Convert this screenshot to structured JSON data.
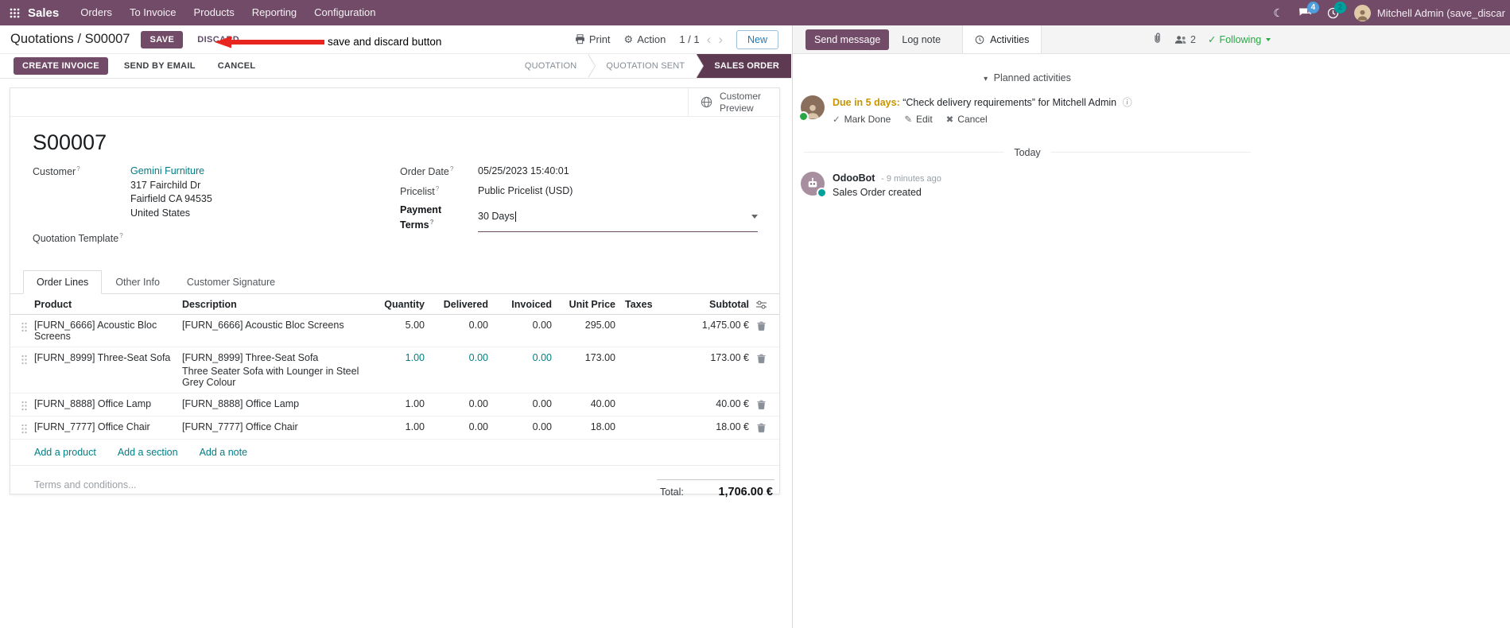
{
  "colors": {
    "primary": "#714B67",
    "statusbar_active": "#5e3a52",
    "link_teal": "#017e84",
    "warning_due": "#c79500",
    "success_green": "#28a745",
    "chat_badge_blue": "#4e9ddd",
    "activity_badge_teal": "#00a09d",
    "annotation_red": "#e8251f"
  },
  "ui": {
    "help": "?"
  },
  "icons": {
    "gear": "⚙",
    "moon": "☾",
    "caret_down": "▾",
    "check": "✓",
    "pencil": "✎",
    "cross": "✖",
    "info": "ⓘ",
    "chevron_left": "‹",
    "chevron_right": "›"
  },
  "annotation": {
    "label": "save and discard button"
  },
  "topbar": {
    "app": "Sales",
    "menus": [
      "Orders",
      "To Invoice",
      "Products",
      "Reporting",
      "Configuration"
    ],
    "chat_badge": "4",
    "activity_badge": "2",
    "user": "Mitchell Admin (save_discar"
  },
  "control": {
    "breadcrumb_parent": "Quotations",
    "breadcrumb_sep": "/",
    "breadcrumb_current": "S00007",
    "save": "SAVE",
    "discard": "DISCARD",
    "print": "Print",
    "action": "Action",
    "pager": "1 / 1",
    "new_label": "New"
  },
  "statusbar": {
    "buttons": [
      "CREATE INVOICE",
      "SEND BY EMAIL",
      "CANCEL"
    ],
    "states": [
      {
        "label": "QUOTATION",
        "active": false
      },
      {
        "label": "QUOTATION SENT",
        "active": false
      },
      {
        "label": "SALES ORDER",
        "active": true
      }
    ]
  },
  "sheet": {
    "customer_preview": "Customer Preview",
    "name": "S00007",
    "fields": {
      "customer_label": "Customer",
      "customer": "Gemini Furniture",
      "address_lines": [
        "317 Fairchild Dr",
        "Fairfield CA 94535",
        "United States"
      ],
      "quotation_template_label": "Quotation Template",
      "order_date_label": "Order Date",
      "order_date": "05/25/2023 15:40:01",
      "pricelist_label": "Pricelist",
      "pricelist": "Public Pricelist (USD)",
      "payment_terms_label": "Payment Terms",
      "payment_terms": "30 Days"
    },
    "tabs": [
      "Order Lines",
      "Other Info",
      "Customer Signature"
    ],
    "table": {
      "headers": [
        "Product",
        "Description",
        "Quantity",
        "Delivered",
        "Invoiced",
        "Unit Price",
        "Taxes",
        "Subtotal"
      ],
      "rows": [
        {
          "product": "[FURN_6666] Acoustic Bloc Screens",
          "description": "[FURN_6666] Acoustic Bloc Screens",
          "description2": "",
          "quantity": "5.00",
          "delivered": "0.00",
          "invoiced": "0.00",
          "unit_price": "295.00",
          "taxes": "",
          "subtotal": "1,475.00 €"
        },
        {
          "product": "[FURN_8999] Three-Seat Sofa",
          "description": "[FURN_8999] Three-Seat Sofa",
          "description2": "Three Seater Sofa with Lounger in Steel Grey Colour",
          "quantity": "1.00",
          "delivered": "0.00",
          "invoiced": "0.00",
          "unit_price": "173.00",
          "taxes": "",
          "subtotal": "173.00 €"
        },
        {
          "product": "[FURN_8888] Office Lamp",
          "description": "[FURN_8888] Office Lamp",
          "description2": "",
          "quantity": "1.00",
          "delivered": "0.00",
          "invoiced": "0.00",
          "unit_price": "40.00",
          "taxes": "",
          "subtotal": "40.00 €"
        },
        {
          "product": "[FURN_7777] Office Chair",
          "description": "[FURN_7777] Office Chair",
          "description2": "",
          "quantity": "1.00",
          "delivered": "0.00",
          "invoiced": "0.00",
          "unit_price": "18.00",
          "taxes": "",
          "subtotal": "18.00 €"
        }
      ],
      "footer_links": [
        "Add a product",
        "Add a section",
        "Add a note"
      ]
    },
    "terms_placeholder": "Terms and conditions...",
    "total_label": "Total:",
    "total": "1,706.00 €"
  },
  "chatter": {
    "send_message": "Send message",
    "log_note": "Log note",
    "activities_tab": "Activities",
    "followers_count": "2",
    "following": "Following",
    "planned_title": "Planned activities",
    "activity": {
      "due": "Due in 5 days:",
      "summary": "“Check delivery requirements”",
      "for_text": "for Mitchell Admin",
      "mark_done": "Mark Done",
      "edit": "Edit",
      "cancel": "Cancel"
    },
    "today": "Today",
    "message": {
      "author": "OdooBot",
      "time": "- 9 minutes ago",
      "body": "Sales Order created"
    }
  }
}
